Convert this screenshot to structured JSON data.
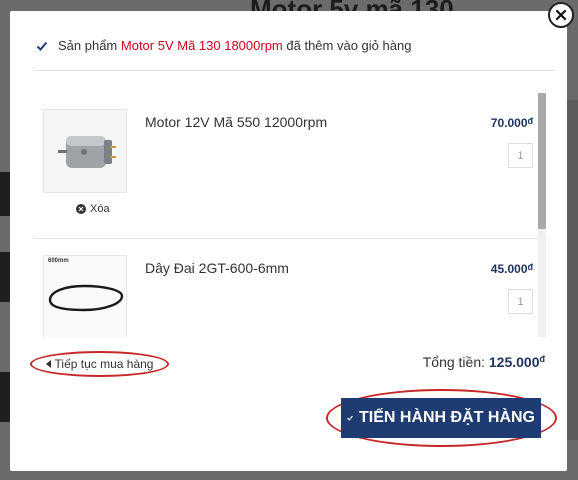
{
  "background": {
    "title": "Motor 5v mã 130"
  },
  "notice": {
    "prefix": "Sản phẩm",
    "product_name": "Motor 5V Mã 130 18000rpm",
    "suffix": "đã thêm vào giỏ hàng"
  },
  "cart": {
    "items": [
      {
        "name": "Motor 12V Mã 550 12000rpm",
        "price": "70.000",
        "currency": "đ",
        "quantity": "1",
        "remove_label": "Xóa"
      },
      {
        "name": "Dây Đai 2GT-600-6mm",
        "price": "45.000",
        "currency": "đ",
        "quantity": "1",
        "thumb_label": "600mm"
      }
    ]
  },
  "footer": {
    "continue_label": "Tiếp tục mua hàng",
    "total_label": "Tổng tiền:",
    "total_amount": "125.000",
    "total_currency": "đ",
    "checkout_label": "TIẾN HÀNH ĐẶT HÀNG"
  },
  "colors": {
    "accent_red": "#d0021b",
    "brand_blue": "#1e3c72",
    "annotation_red": "#c62828"
  }
}
